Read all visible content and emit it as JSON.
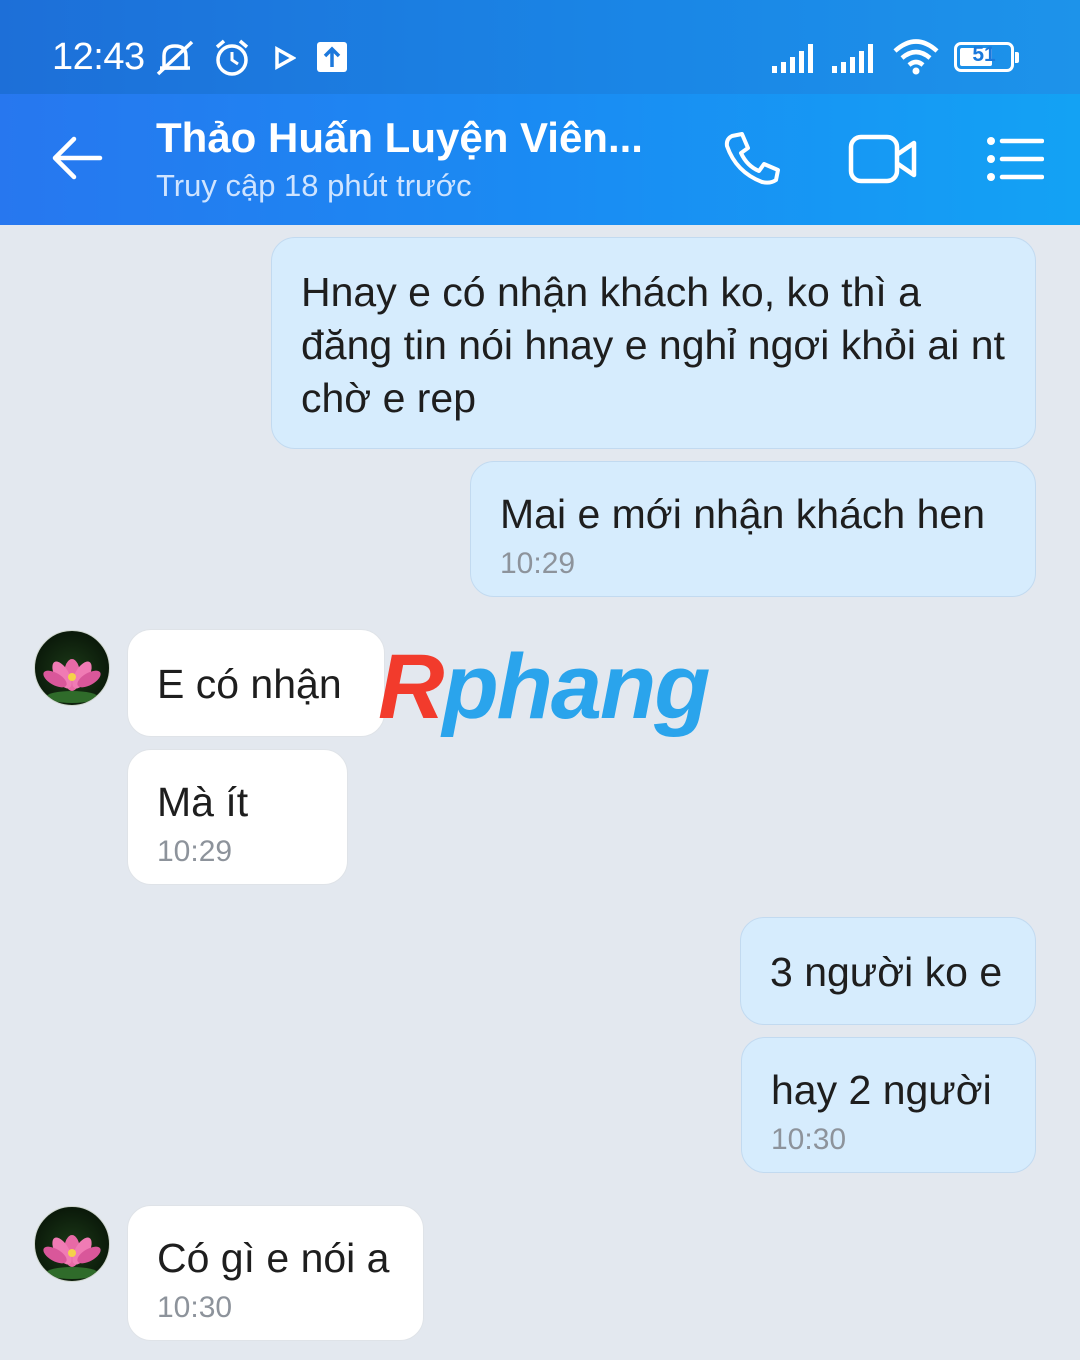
{
  "status_bar": {
    "time": "12:43",
    "battery": "51",
    "icons": [
      "mute-bell-icon",
      "alarm-icon",
      "play-icon",
      "upload-icon",
      "signal-icon",
      "signal-icon",
      "wifi-icon",
      "battery-icon"
    ]
  },
  "header": {
    "title": "Thảo Huấn Luyện Viên...",
    "subtitle": "Truy cập 18 phút trước",
    "icons": [
      "back-arrow-icon",
      "phone-icon",
      "video-icon",
      "menu-list-icon"
    ]
  },
  "messages": [
    {
      "direction": "out",
      "text": "Hnay e có nhận khách ko, ko thì a đăng tin nói hnay e nghỉ ngơi khỏi ai nt chờ e rep",
      "time": ""
    },
    {
      "direction": "out",
      "text": "Mai e mới nhận khách hen",
      "time": "10:29"
    },
    {
      "direction": "in",
      "text": "E có nhận",
      "time": ""
    },
    {
      "direction": "in",
      "text": "Mà ít",
      "time": "10:29"
    },
    {
      "direction": "out",
      "text": "3 người ko e",
      "time": ""
    },
    {
      "direction": "out",
      "text": "hay 2 người",
      "time": "10:30"
    },
    {
      "direction": "in",
      "text": "Có gì e nói a",
      "time": "10:30"
    }
  ],
  "watermark": {
    "first": "R",
    "rest": "phang"
  },
  "colors": {
    "accent": "#1a8bf3",
    "outgoing_bubble": "#d6ecfd",
    "incoming_bubble": "#ffffff",
    "background": "#e3e8ef"
  }
}
